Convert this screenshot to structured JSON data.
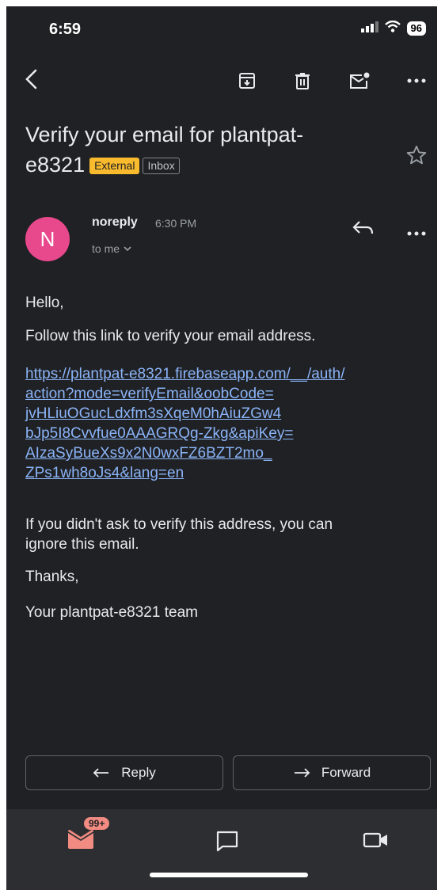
{
  "status_bar": {
    "time": "6:59",
    "battery": "96"
  },
  "email": {
    "subject_line1": "Verify your email for plantpat-",
    "subject_line2": "e8321",
    "badge_external": "External",
    "badge_inbox": "Inbox",
    "avatar_letter": "N",
    "sender": "noreply",
    "time": "6:30 PM",
    "recipient": "to me",
    "body": {
      "greeting": "Hello,",
      "instruction": "Follow this link to verify your email address.",
      "link_lines": [
        "https://plantpat-e8321.firebaseapp.com/__/auth/",
        "action?mode=verifyEmail&oobCode=",
        "jvHLiuOGucLdxfm3sXqeM0hAiuZGw4",
        "bJp5I8Cvvfue0AAAGRQg-Zkg&apiKey=",
        "AIzaSyBueXs9x2N0wxFZ6BZT2mo_",
        "ZPs1wh8oJs4&lang=en"
      ],
      "ignore_line1": "If you didn't ask to verify this address, you can",
      "ignore_line2": "ignore this email.",
      "thanks": "Thanks,",
      "signature": "Your plantpat-e8321 team"
    }
  },
  "actions": {
    "reply": "Reply",
    "forward": "Forward"
  },
  "bottom_nav": {
    "mail_badge": "99+"
  },
  "colors": {
    "background": "#202124",
    "accent_link": "#8ab4f8",
    "badge_external": "#f9bb2d",
    "avatar": "#e8488c",
    "mail_icon": "#f28b82"
  },
  "icons": [
    "back-icon",
    "archive-icon",
    "trash-icon",
    "mark-unread-icon",
    "more-icon",
    "star-icon",
    "reply-icon",
    "forward-icon",
    "mail-icon",
    "chat-icon",
    "video-icon"
  ]
}
